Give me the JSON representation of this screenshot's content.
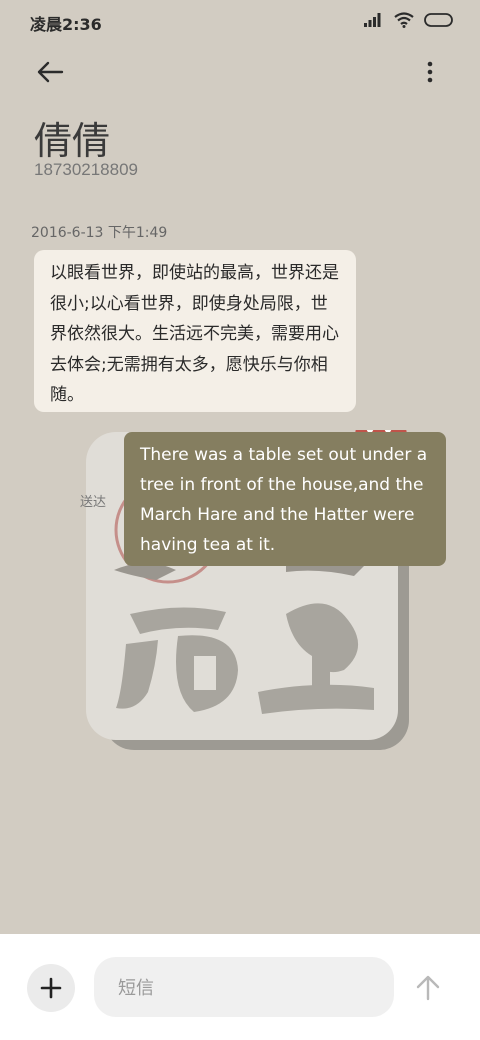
{
  "status_bar": {
    "time": "凌晨2:36"
  },
  "header": {
    "contact_name": "倩倩",
    "contact_number": "18730218809"
  },
  "conversation": {
    "timestamp": "2016-6-13 下午1:49",
    "incoming_message": "以眼看世界，即使站的最高，世界还是很小;以心看世界，即使身处局限，世界依然很大。生活远不完美，需要用心去体会;无需拥有太多，愿快乐与你相随。",
    "sent_status": "送达",
    "outgoing_message": "There was a table set out under a tree in front of the house,and the March Hare and the Hatter were having tea at it."
  },
  "composer": {
    "placeholder": "短信"
  },
  "colors": {
    "background": "#d2ccc2",
    "incoming_bubble": "#f4efe7",
    "outgoing_bubble": "#857e60",
    "composer_bg": "#ffffff"
  },
  "icons": [
    "back-arrow-icon",
    "more-vertical-icon",
    "signal-icon",
    "wifi-icon",
    "battery-icon",
    "plus-icon",
    "send-arrow-icon"
  ]
}
